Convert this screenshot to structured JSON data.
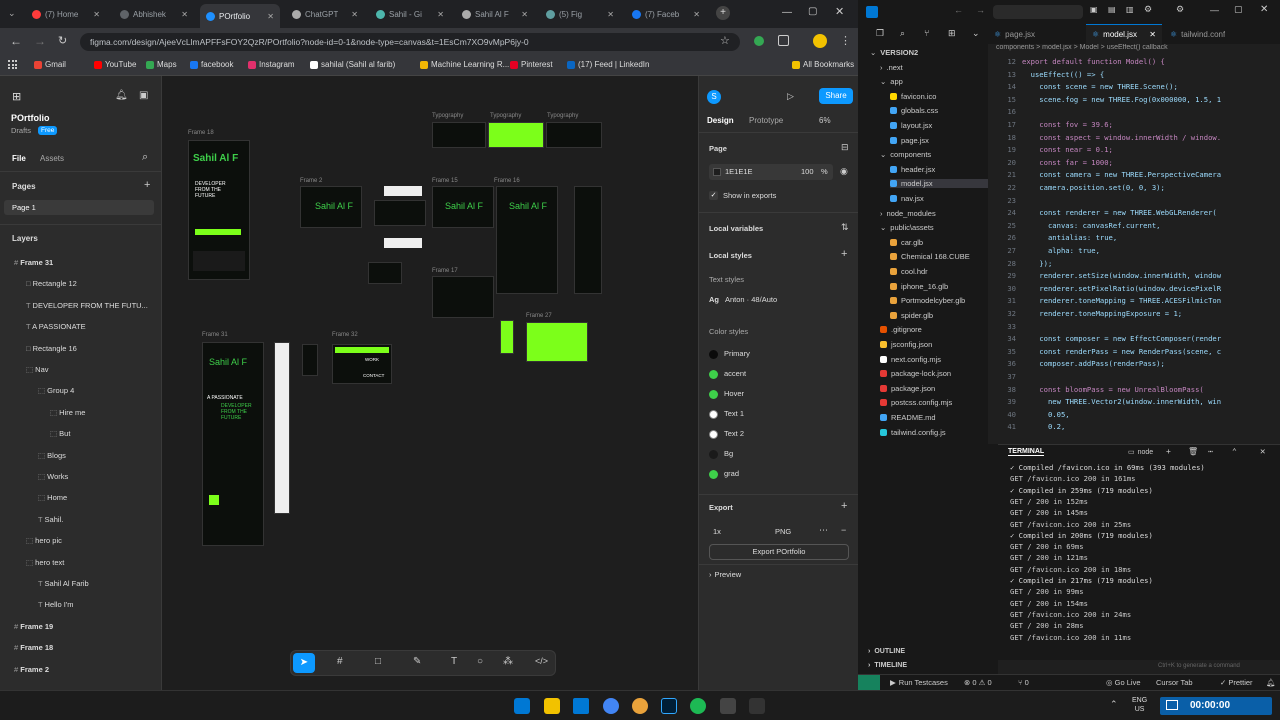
{
  "browser": {
    "tabs": [
      {
        "label": "(7) Home",
        "color": "#ff3b3b"
      },
      {
        "label": "Abhishek",
        "color": "#5f6368"
      },
      {
        "label": "POrtfolio",
        "color": "#1e90ff"
      },
      {
        "label": "ChatGPT",
        "color": "#aaa"
      },
      {
        "label": "Sahil - Gi",
        "color": "#4db6ac"
      },
      {
        "label": "Sahil Al F",
        "color": "#aaa"
      },
      {
        "label": "(5) Fig",
        "color": "#5f9ea0"
      },
      {
        "label": "(7) Faceb",
        "color": "#1877f2"
      }
    ],
    "url": "figma.com/design/AjeeVcLlmAPFFsFOY2QzR/POrtfolio?node-id=0-1&node-type=canvas&t=1EsCm7XO9vMpP6jy-0",
    "bookmarks": [
      {
        "label": "Gmail",
        "color": "#ea4335"
      },
      {
        "label": "YouTube",
        "color": "#ff0000"
      },
      {
        "label": "Maps",
        "color": "#34a853"
      },
      {
        "label": "facebook",
        "color": "#1877f2"
      },
      {
        "label": "Instagram",
        "color": "#e1306c"
      },
      {
        "label": "sahilal (Sahil al farib)",
        "color": "#ffffff"
      },
      {
        "label": "Machine Learning R...",
        "color": "#f2b705"
      },
      {
        "label": "Pinterest",
        "color": "#e60023"
      },
      {
        "label": "(17) Feed | LinkedIn",
        "color": "#0a66c2"
      }
    ],
    "all_bookmarks": "All Bookmarks"
  },
  "figma": {
    "file_name": "POrtfolio",
    "drafts": "Drafts",
    "free": "Free",
    "tab_file": "File",
    "tab_assets": "Assets",
    "pages_label": "Pages",
    "page1": "Page 1",
    "layers_label": "Layers",
    "layers": [
      {
        "label": "Frame 31",
        "indent": 0
      },
      {
        "label": "Rectangle 12",
        "indent": 1
      },
      {
        "label": "DEVELOPER FROM THE FUTU...",
        "indent": 1
      },
      {
        "label": "A PASSIONATE",
        "indent": 1
      },
      {
        "label": "Rectangle 16",
        "indent": 1
      },
      {
        "label": "Nav",
        "indent": 1
      },
      {
        "label": "Group 4",
        "indent": 2
      },
      {
        "label": "Hire me",
        "indent": 3
      },
      {
        "label": "But",
        "indent": 3
      },
      {
        "label": "Blogs",
        "indent": 2
      },
      {
        "label": "Works",
        "indent": 2
      },
      {
        "label": "Home",
        "indent": 2
      },
      {
        "label": "Sahil.",
        "indent": 2
      },
      {
        "label": "hero pic",
        "indent": 1
      },
      {
        "label": "hero text",
        "indent": 1
      },
      {
        "label": "Sahil Al Farib",
        "indent": 2
      },
      {
        "label": "Hello I'm",
        "indent": 2
      },
      {
        "label": "Frame 19",
        "indent": 0
      },
      {
        "label": "Frame 18",
        "indent": 0
      },
      {
        "label": "Frame 2",
        "indent": 0
      }
    ],
    "canvas": {
      "frame18": "Frame 18",
      "frame2": "Frame 2",
      "frame15": "Frame 15",
      "frame16": "Frame 16",
      "frame17": "Frame 17",
      "frame27": "Frame 27",
      "frame31": "Frame 31",
      "frame32": "Frame 32",
      "typography": "Typography",
      "hero_text": "Sahil Al F",
      "passionate": "A PASSIONATE",
      "developer": "DEVELOPER FROM THE FUTURE",
      "work": "WORK",
      "contact": "CONTACT"
    },
    "right": {
      "design": "Design",
      "prototype": "Prototype",
      "zoom": "6%",
      "share": "Share",
      "avatar": "S",
      "page": "Page",
      "page_color": "1E1E1E",
      "page_opacity": "100",
      "page_opacity_unit": "%",
      "show_exports": "Show in exports",
      "local_variables": "Local variables",
      "local_styles": "Local styles",
      "text_styles": "Text styles",
      "text_style": "Anton · 48/Auto",
      "color_styles": "Color styles",
      "colors": [
        {
          "name": "Primary",
          "hex": "#0b0b0b"
        },
        {
          "name": "accent",
          "hex": "#3ecf4a"
        },
        {
          "name": "Hover",
          "hex": "#3ecf4a"
        },
        {
          "name": "Text 1",
          "hex": "#ffffff"
        },
        {
          "name": "Text 2",
          "hex": "#ffffff"
        },
        {
          "name": "Bg",
          "hex": "#1a1a1a"
        },
        {
          "name": "grad",
          "hex": "#3ecf4a"
        }
      ],
      "export": "Export",
      "export_scale": "1x",
      "export_format": "PNG",
      "export_btn": "Export POrtfolio",
      "preview": "Preview"
    }
  },
  "vscode": {
    "title": "VERSION2",
    "tabs": [
      {
        "label": "page.jsx",
        "active": false
      },
      {
        "label": "model.jsx",
        "active": true
      },
      {
        "label": "tailwind.conf",
        "active": false
      }
    ],
    "breadcrumb": "components > model.jsx > Model > useEffect() callback",
    "explorer": [
      {
        "label": "VERSION2",
        "indent": 0,
        "color": "#888"
      },
      {
        "label": ".next",
        "indent": 1,
        "color": "#888"
      },
      {
        "label": "app",
        "indent": 1,
        "color": "#888"
      },
      {
        "label": "favicon.ico",
        "indent": 2,
        "color": "#ffd700"
      },
      {
        "label": "globals.css",
        "indent": 2,
        "color": "#42a5f5"
      },
      {
        "label": "layout.jsx",
        "indent": 2,
        "color": "#42a5f5"
      },
      {
        "label": "page.jsx",
        "indent": 2,
        "color": "#42a5f5"
      },
      {
        "label": "components",
        "indent": 1,
        "color": "#888"
      },
      {
        "label": "header.jsx",
        "indent": 2,
        "color": "#42a5f5"
      },
      {
        "label": "model.jsx",
        "indent": 2,
        "color": "#42a5f5"
      },
      {
        "label": "nav.jsx",
        "indent": 2,
        "color": "#42a5f5"
      },
      {
        "label": "node_modules",
        "indent": 1,
        "color": "#888"
      },
      {
        "label": "public\\assets",
        "indent": 1,
        "color": "#888"
      },
      {
        "label": "car.glb",
        "indent": 2,
        "color": "#e9a23b"
      },
      {
        "label": "Chemical 168.CUBE",
        "indent": 2,
        "color": "#e9a23b"
      },
      {
        "label": "cool.hdr",
        "indent": 2,
        "color": "#e9a23b"
      },
      {
        "label": "iphone_16.glb",
        "indent": 2,
        "color": "#e9a23b"
      },
      {
        "label": "Portmodelcyber.glb",
        "indent": 2,
        "color": "#e9a23b"
      },
      {
        "label": "spider.glb",
        "indent": 2,
        "color": "#e9a23b"
      },
      {
        "label": ".gitignore",
        "indent": 1,
        "color": "#e65100"
      },
      {
        "label": "jsconfig.json",
        "indent": 1,
        "color": "#fbc02d"
      },
      {
        "label": "next.config.mjs",
        "indent": 1,
        "color": "#fff"
      },
      {
        "label": "package-lock.json",
        "indent": 1,
        "color": "#e53935"
      },
      {
        "label": "package.json",
        "indent": 1,
        "color": "#e53935"
      },
      {
        "label": "postcss.config.mjs",
        "indent": 1,
        "color": "#e53935"
      },
      {
        "label": "README.md",
        "indent": 1,
        "color": "#42a5f5"
      },
      {
        "label": "tailwind.config.js",
        "indent": 1,
        "color": "#26c6da"
      }
    ],
    "code": [
      {
        "n": "12",
        "t": "export default function Model() {"
      },
      {
        "n": "13",
        "t": "  useEffect(() => {"
      },
      {
        "n": "14",
        "t": "    const scene = new THREE.Scene();"
      },
      {
        "n": "15",
        "t": "    scene.fog = new THREE.Fog(0x000000, 1.5, 1"
      },
      {
        "n": "16",
        "t": ""
      },
      {
        "n": "17",
        "t": "    const fov = 39.6;"
      },
      {
        "n": "18",
        "t": "    const aspect = window.innerWidth / window."
      },
      {
        "n": "19",
        "t": "    const near = 0.1;"
      },
      {
        "n": "20",
        "t": "    const far = 1000;"
      },
      {
        "n": "21",
        "t": "    const camera = new THREE.PerspectiveCamera"
      },
      {
        "n": "22",
        "t": "    camera.position.set(0, 0, 3);"
      },
      {
        "n": "23",
        "t": ""
      },
      {
        "n": "24",
        "t": "    const renderer = new THREE.WebGLRenderer("
      },
      {
        "n": "25",
        "t": "      canvas: canvasRef.current,"
      },
      {
        "n": "26",
        "t": "      antialias: true,"
      },
      {
        "n": "27",
        "t": "      alpha: true,"
      },
      {
        "n": "28",
        "t": "    });"
      },
      {
        "n": "29",
        "t": "    renderer.setSize(window.innerWidth, window"
      },
      {
        "n": "30",
        "t": "    renderer.setPixelRatio(window.devicePixelR"
      },
      {
        "n": "31",
        "t": "    renderer.toneMapping = THREE.ACESFilmicTon"
      },
      {
        "n": "32",
        "t": "    renderer.toneMappingExposure = 1;"
      },
      {
        "n": "33",
        "t": ""
      },
      {
        "n": "34",
        "t": "    const composer = new EffectComposer(render"
      },
      {
        "n": "35",
        "t": "    const renderPass = new RenderPass(scene, c"
      },
      {
        "n": "36",
        "t": "    composer.addPass(renderPass);"
      },
      {
        "n": "37",
        "t": ""
      },
      {
        "n": "38",
        "t": "    const bloomPass = new UnrealBloomPass("
      },
      {
        "n": "39",
        "t": "      new THREE.Vector2(window.innerWidth, win"
      },
      {
        "n": "40",
        "t": "      0.05,"
      },
      {
        "n": "41",
        "t": "      0.2,"
      }
    ],
    "terminal_label": "TERMINAL",
    "terminal_shell": "node",
    "terminal": [
      "✓ Compiled /favicon.ico in 69ms (393 modules)",
      "GET /favicon.ico 200 in 161ms",
      "✓ Compiled in 259ms (719 modules)",
      "GET / 200 in 152ms",
      "GET / 200 in 145ms",
      "GET /favicon.ico 200 in 25ms",
      "✓ Compiled in 200ms (719 modules)",
      "GET / 200 in 69ms",
      "GET / 200 in 121ms",
      "GET /favicon.ico 200 in 18ms",
      "✓ Compiled in 217ms (719 modules)",
      "GET / 200 in 99ms",
      "GET / 200 in 154ms",
      "GET /favicon.ico 200 in 24ms",
      "GET / 200 in 28ms",
      "GET /favicon.ico 200 in 11ms"
    ],
    "outline": "OUTLINE",
    "timeline": "TIMELINE",
    "status": {
      "run_testcases": "Run Testcases",
      "errors": "0",
      "warnings": "0",
      "ports": "0",
      "go_live": "Go Live",
      "cursor_tab": "Cursor Tab",
      "prettier": "Prettier"
    },
    "hint": "Ctrl+K to generate a command"
  },
  "taskbar": {
    "lang1": "ENG",
    "lang2": "US",
    "clock": "00:00:00"
  }
}
